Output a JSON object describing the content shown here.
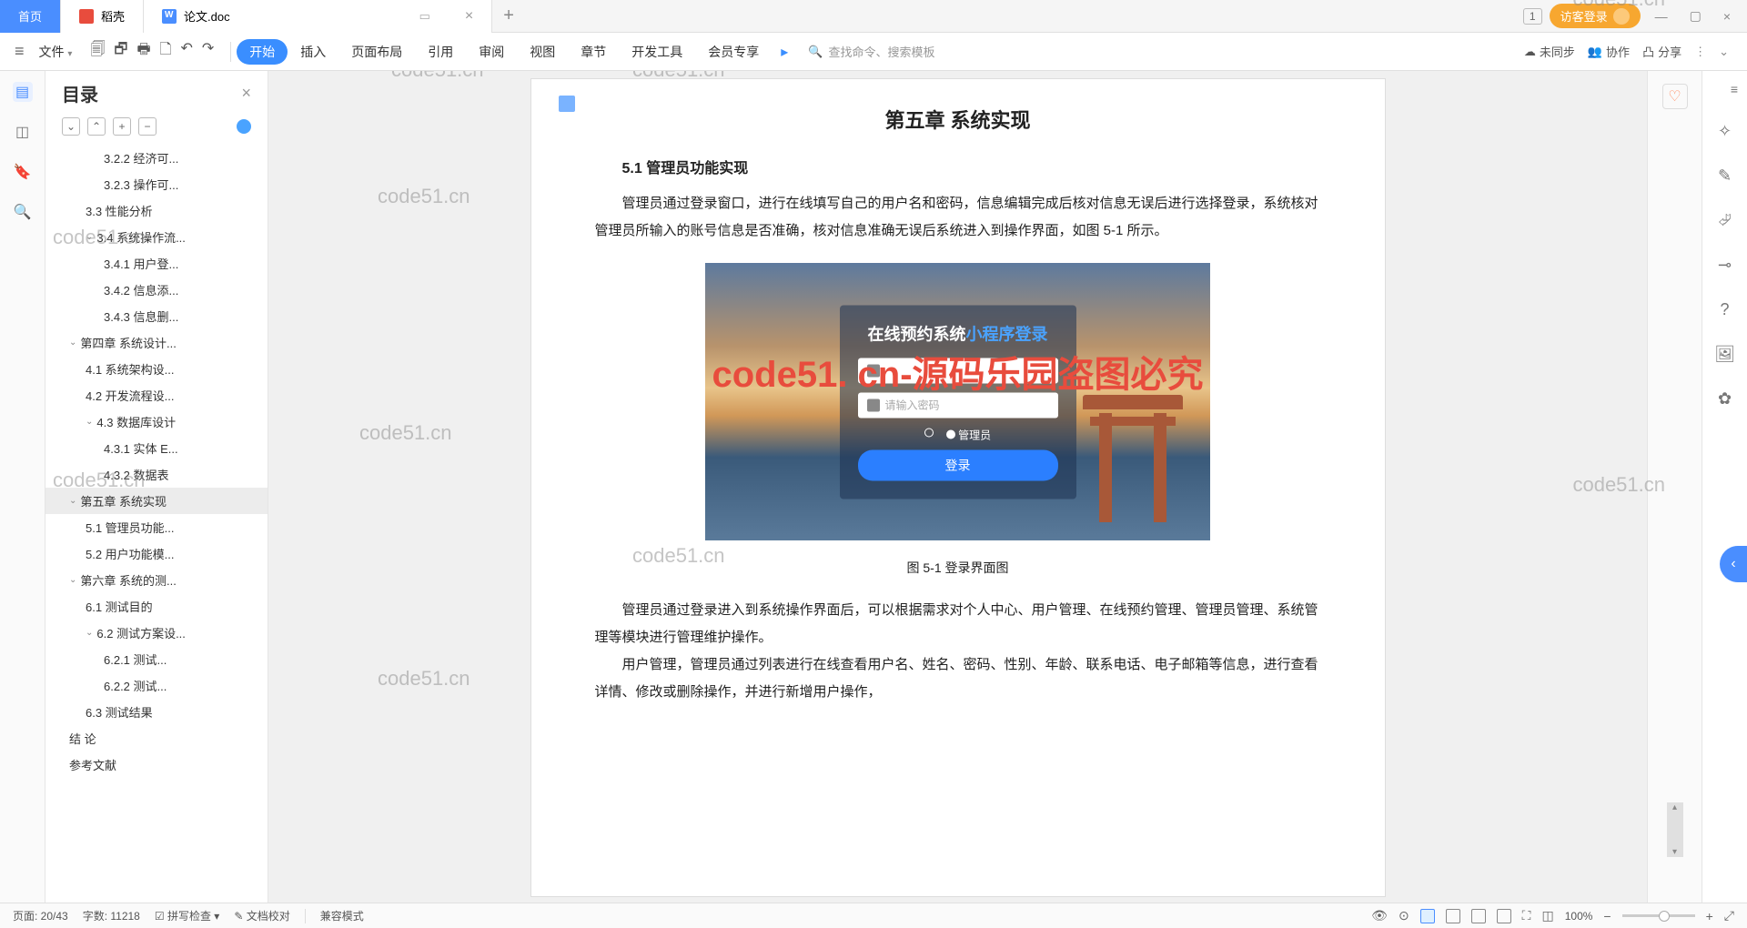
{
  "titlebar": {
    "home": "首页",
    "daoke": "稻壳",
    "doc": "论文.doc",
    "badge": "1",
    "login": "访客登录"
  },
  "toolbar": {
    "file": "文件",
    "tabs": [
      "开始",
      "插入",
      "页面布局",
      "引用",
      "审阅",
      "视图",
      "章节",
      "开发工具",
      "会员专享"
    ],
    "search_placeholder": "查找命令、搜索模板",
    "unsync": "未同步",
    "collab": "协作",
    "share": "分享"
  },
  "outline": {
    "title": "目录",
    "items": [
      {
        "lv": 3,
        "text": "3.2.2 经济可..."
      },
      {
        "lv": 3,
        "text": "3.2.3 操作可..."
      },
      {
        "lv": 2,
        "text": "3.3 性能分析"
      },
      {
        "lv": 2,
        "text": "3.4 系统操作流...",
        "chev": true
      },
      {
        "lv": 3,
        "text": "3.4.1 用户登..."
      },
      {
        "lv": 3,
        "text": "3.4.2 信息添..."
      },
      {
        "lv": 3,
        "text": "3.4.3 信息删..."
      },
      {
        "lv": 1,
        "text": "第四章  系统设计...",
        "chev": true
      },
      {
        "lv": 2,
        "text": "4.1 系统架构设..."
      },
      {
        "lv": 2,
        "text": "4.2 开发流程设..."
      },
      {
        "lv": 2,
        "text": "4.3 数据库设计",
        "chev": true
      },
      {
        "lv": 3,
        "text": "4.3.1 实体 E..."
      },
      {
        "lv": 3,
        "text": "4.3.2 数据表"
      },
      {
        "lv": 1,
        "text": "第五章  系统实现",
        "chev": true,
        "selected": true
      },
      {
        "lv": 2,
        "text": "5.1 管理员功能..."
      },
      {
        "lv": 2,
        "text": "5.2 用户功能模..."
      },
      {
        "lv": 1,
        "text": "第六章   系统的测...",
        "chev": true
      },
      {
        "lv": 2,
        "text": "6.1 测试目的"
      },
      {
        "lv": 2,
        "text": "6.2 测试方案设...",
        "chev": true
      },
      {
        "lv": 3,
        "text": "6.2.1 测试..."
      },
      {
        "lv": 3,
        "text": "6.2.2 测试..."
      },
      {
        "lv": 2,
        "text": "6.3 测试结果"
      },
      {
        "lv": 1,
        "text": "结   论"
      },
      {
        "lv": 1,
        "text": "参考文献"
      }
    ]
  },
  "document": {
    "chapter_title": "第五章  系统实现",
    "section_title": "5.1  管理员功能实现",
    "para1": "管理员通过登录窗口，进行在线填写自己的用户名和密码，信息编辑完成后核对信息无误后进行选择登录，系统核对管理员所输入的账号信息是否准确，核对信息准确无误后系统进入到操作界面，如图 5-1 所示。",
    "caption": "图 5-1 登录界面图",
    "para2": "管理员通过登录进入到系统操作界面后，可以根据需求对个人中心、用户管理、在线预约管理、管理员管理、系统管理等模块进行管理维护操作。",
    "para3": "用户管理，管理员通过列表进行在线查看用户名、姓名、密码、性别、年龄、联系电话、电子邮箱等信息，进行查看详情、修改或删除操作，并进行新增用户操作，",
    "login_panel": {
      "title_white": "在线预约系统",
      "title_blue": "小程序登录",
      "pwd_placeholder": "请输入密码",
      "role_admin": "管理员",
      "btn": "登录"
    }
  },
  "watermarks": {
    "wm": "code51.cn",
    "center": "code51. cn-源码乐园盗图必究"
  },
  "statusbar": {
    "page": "页面: 20/43",
    "words": "字数: 11218",
    "spell": "拼写检查",
    "proof": "文档校对",
    "compat": "兼容模式",
    "zoom": "100%"
  }
}
